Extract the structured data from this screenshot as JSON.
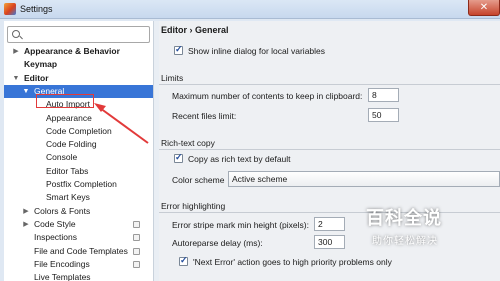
{
  "window": {
    "title": "Settings",
    "close_glyph": "✕"
  },
  "search": {
    "value": "",
    "placeholder": ""
  },
  "tree": [
    {
      "label": "Appearance & Behavior",
      "arrow": "▶",
      "bold": true
    },
    {
      "label": "Keymap",
      "arrow": "",
      "bold": true
    },
    {
      "label": "Editor",
      "arrow": "▼",
      "bold": true
    },
    {
      "label": "General",
      "arrow": "▼",
      "bold": false,
      "selected": true
    },
    {
      "label": "Auto Import",
      "arrow": "",
      "bold": false
    },
    {
      "label": "Appearance",
      "arrow": "",
      "bold": false
    },
    {
      "label": "Code Completion",
      "arrow": "",
      "bold": false
    },
    {
      "label": "Code Folding",
      "arrow": "",
      "bold": false
    },
    {
      "label": "Console",
      "arrow": "",
      "bold": false
    },
    {
      "label": "Editor Tabs",
      "arrow": "",
      "bold": false
    },
    {
      "label": "Postfix Completion",
      "arrow": "",
      "bold": false
    },
    {
      "label": "Smart Keys",
      "arrow": "",
      "bold": false
    },
    {
      "label": "Colors & Fonts",
      "arrow": "▶",
      "bold": false
    },
    {
      "label": "Code Style",
      "arrow": "▶",
      "bold": false,
      "cfg": true
    },
    {
      "label": "Inspections",
      "arrow": "",
      "bold": false,
      "cfg": true
    },
    {
      "label": "File and Code Templates",
      "arrow": "",
      "bold": false,
      "cfg": true
    },
    {
      "label": "File Encodings",
      "arrow": "",
      "bold": false,
      "cfg": true
    },
    {
      "label": "Live Templates",
      "arrow": "",
      "bold": false
    }
  ],
  "right": {
    "breadcrumb": "Editor › General",
    "inline_dialog": {
      "label": "Show inline dialog for local variables",
      "checked": true
    },
    "limits": {
      "header": "Limits",
      "clipboard_label": "Maximum number of contents to keep in clipboard:",
      "clipboard_value": "8",
      "recent_label": "Recent files limit:",
      "recent_value": "50"
    },
    "rich_text": {
      "header": "Rich-text copy",
      "copy_label": "Copy as rich text by default",
      "copy_checked": true,
      "scheme_label": "Color scheme",
      "scheme_value": "Active scheme"
    },
    "error_highlighting": {
      "header": "Error highlighting",
      "stripe_label": "Error stripe mark min height (pixels):",
      "stripe_value": "2",
      "autoreparse_label": "Autoreparse delay (ms):",
      "autoreparse_value": "300",
      "next_error_label": "'Next Error' action goes to high priority problems only",
      "next_error_checked": true
    }
  },
  "watermark": {
    "title": "百科全说",
    "subtitle": "助你轻松解决"
  },
  "colors": {
    "selection": "#3875d7",
    "annotation": "#e23a3a"
  }
}
